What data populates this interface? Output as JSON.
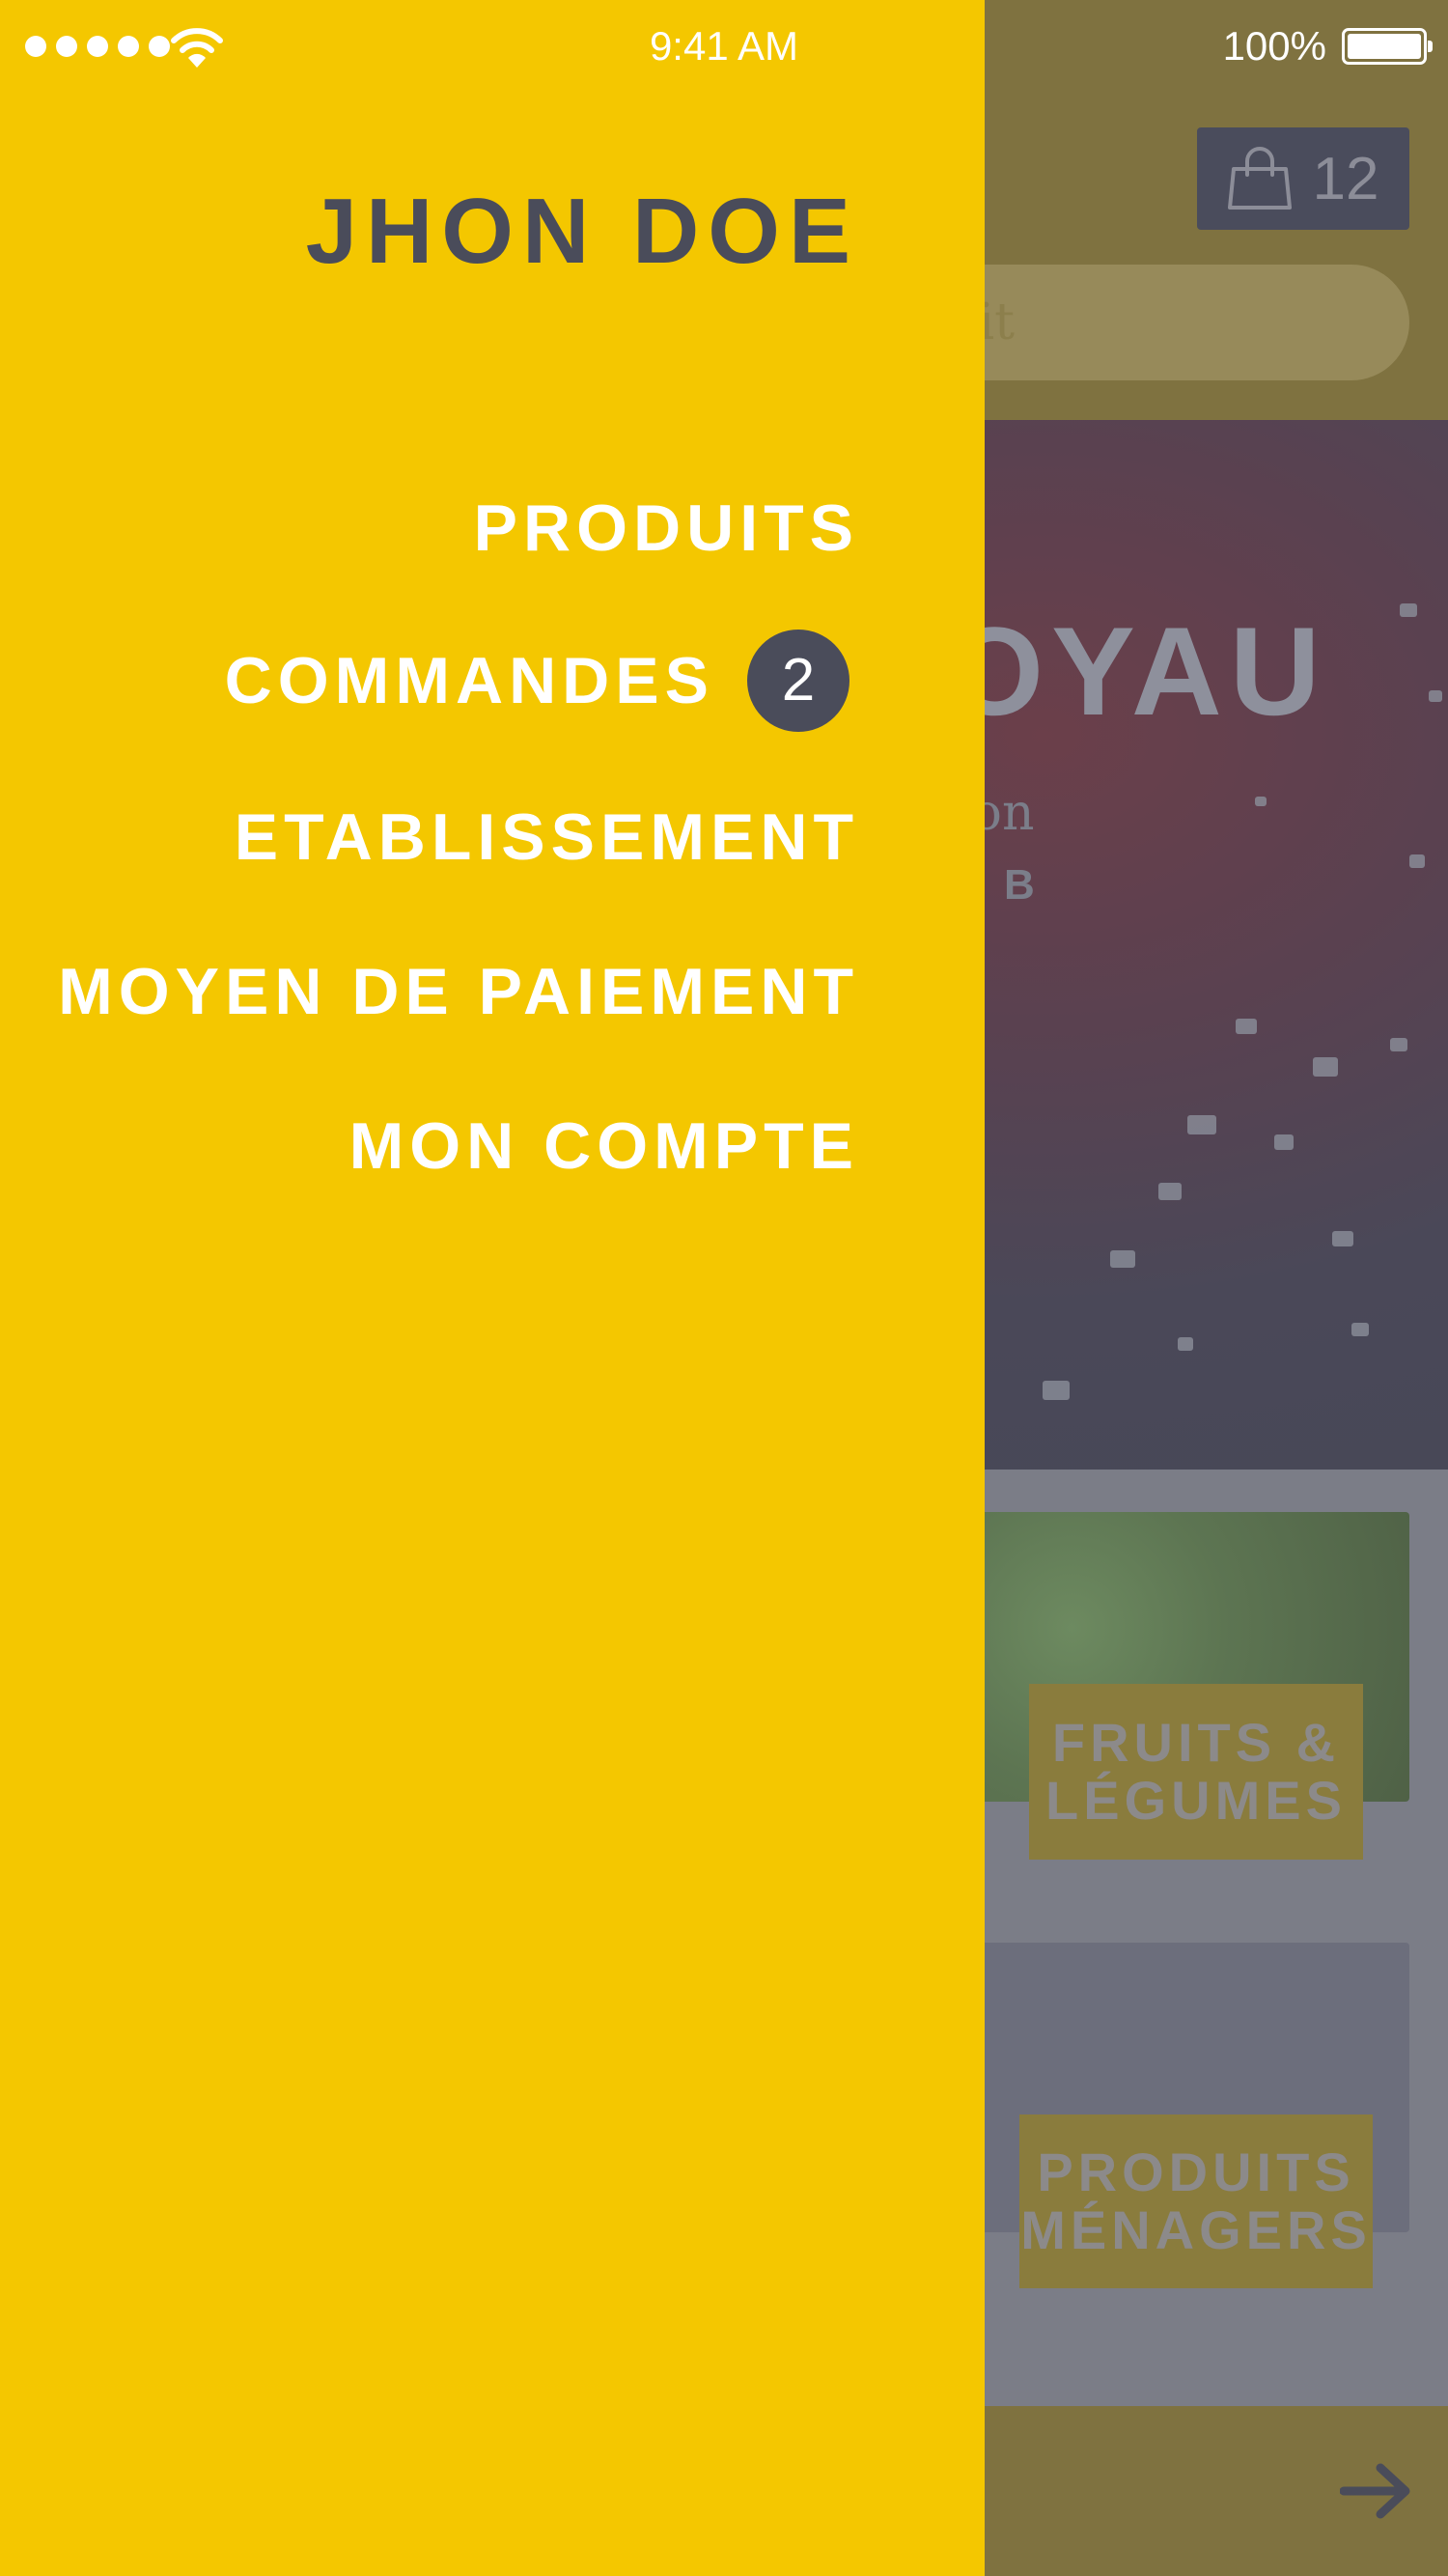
{
  "status_bar": {
    "time": "9:41 AM",
    "battery_percent": "100%",
    "signal_bars": 5
  },
  "drawer": {
    "user_name": "JHON DOE",
    "background_color": "#f4c700",
    "menu": [
      {
        "label": "PRODUITS",
        "badge": null
      },
      {
        "label": "COMMANDES",
        "badge": "2"
      },
      {
        "label": "ETABLISSEMENT",
        "badge": null
      },
      {
        "label": "MOYEN DE PAIEMENT",
        "badge": null
      },
      {
        "label": "MON COMPTE",
        "badge": null
      }
    ]
  },
  "background_app": {
    "cart": {
      "count": "12",
      "icon": "shopping-bag-icon"
    },
    "search": {
      "visible_text": "uit"
    },
    "hero": {
      "title_visible": "OYAU",
      "subtitle_visible": "son",
      "caption_visible": "R B"
    },
    "categories": [
      {
        "label": "FRUITS &\nLÉGUMES"
      },
      {
        "label": "PRODUITS\nMÉNAGERS"
      }
    ],
    "next_icon": "arrow-right-icon"
  },
  "colors": {
    "accent": "#f4c700",
    "dark": "#4a4c5a",
    "overlay_tint": "#7f7240"
  }
}
